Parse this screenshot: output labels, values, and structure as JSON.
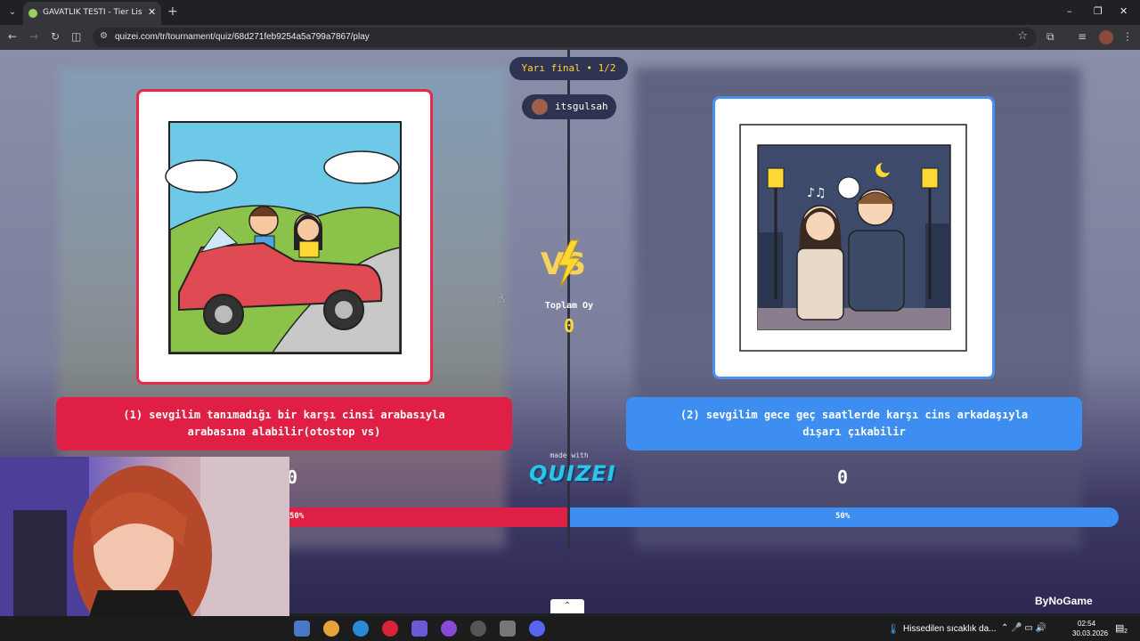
{
  "browser": {
    "tab_title": "GAVATLIK TESTİ - Tier List, Kör Ka",
    "tab_close": "✕",
    "new_tab": "+",
    "url": "quizei.com/tr/tournament/quiz/68d271feb9254a5a799a7867/play",
    "window_controls": [
      "–",
      "❐",
      "✕"
    ]
  },
  "quiz": {
    "stage": "Yarı final • 1/2",
    "username": "itsgulsah",
    "total_votes_label": "Toplam Oy",
    "total_votes_value": "0",
    "options": [
      {
        "text": "(1) sevgilim tanımadığı bir karşı cinsi arabasıyla arabasına alabilir(otostop vs)",
        "score": "0",
        "percent_label": "50%",
        "color": "#e01f45"
      },
      {
        "text": "(2) sevgilim gece geç saatlerde karşı cins arkadaşıyla dışarı çıkabilir",
        "score": "0",
        "percent_label": "50%",
        "color": "#3d8ef0"
      }
    ],
    "vote_share": [
      0.5,
      0.5
    ],
    "made_with": "made with",
    "brand": "QUIZEI"
  },
  "overlay": {
    "bynogame": "ByNoGame"
  },
  "taskbar": {
    "weather": "Hissedilen sıcaklık da...",
    "time": "02:54",
    "date": "30.03.2026",
    "notif_count": "2"
  }
}
